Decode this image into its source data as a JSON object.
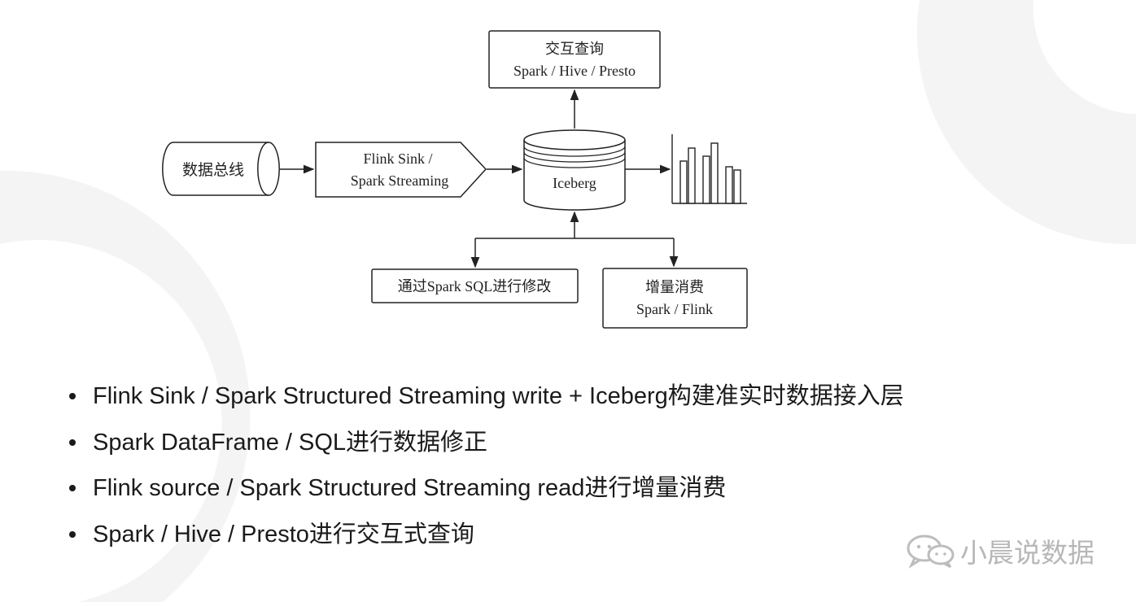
{
  "diagram": {
    "nodes": {
      "bus": "数据总线",
      "ingest_line1": "Flink Sink /",
      "ingest_line2": "Spark Streaming",
      "store": "Iceberg",
      "query_line1": "交互查询",
      "query_line2": "Spark / Hive / Presto",
      "modify": "通过Spark SQL进行修改",
      "incremental_line1": "增量消费",
      "incremental_line2": "Spark / Flink"
    },
    "colors": {
      "line": "#222222",
      "box_fill": "#ffffff"
    }
  },
  "bullets": [
    "Flink Sink / Spark Structured Streaming write + Iceberg构建准实时数据接入层",
    "Spark DataFrame / SQL进行数据修正",
    "Flink source / Spark Structured Streaming read进行增量消费",
    "Spark / Hive / Presto进行交互式查询"
  ],
  "watermark": {
    "text": "小晨说数据",
    "icon": "wechat-icon"
  }
}
